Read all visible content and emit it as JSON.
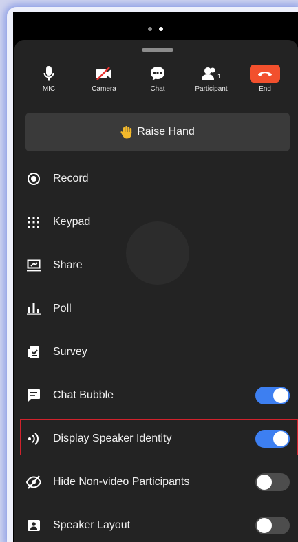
{
  "toolbar": {
    "mic": "MIC",
    "camera": "Camera",
    "chat": "Chat",
    "participant": "Participant",
    "participant_count": "1",
    "end": "End"
  },
  "raise_hand": {
    "label": "Raise Hand"
  },
  "menu": {
    "record": "Record",
    "keypad": "Keypad",
    "share": "Share",
    "poll": "Poll",
    "survey": "Survey",
    "chat_bubble": "Chat Bubble",
    "display_speaker_identity": "Display Speaker Identity",
    "hide_non_video": "Hide Non-video Participants",
    "speaker_layout": "Speaker Layout"
  },
  "toggles": {
    "chat_bubble": true,
    "display_speaker_identity": true,
    "hide_non_video": false,
    "speaker_layout": false
  },
  "colors": {
    "end_button": "#f2502d",
    "toggle_on": "#3d7ff1",
    "highlight": "#d1222c",
    "sheet_bg": "#232323"
  },
  "icons": [
    "mic-icon",
    "camera-off-icon",
    "chat-icon",
    "participant-icon",
    "end-call-icon",
    "raise-hand-icon",
    "record-icon",
    "keypad-icon",
    "share-icon",
    "poll-icon",
    "survey-icon",
    "chat-bubble-icon",
    "speaker-identity-icon",
    "hide-video-icon",
    "speaker-layout-icon"
  ]
}
